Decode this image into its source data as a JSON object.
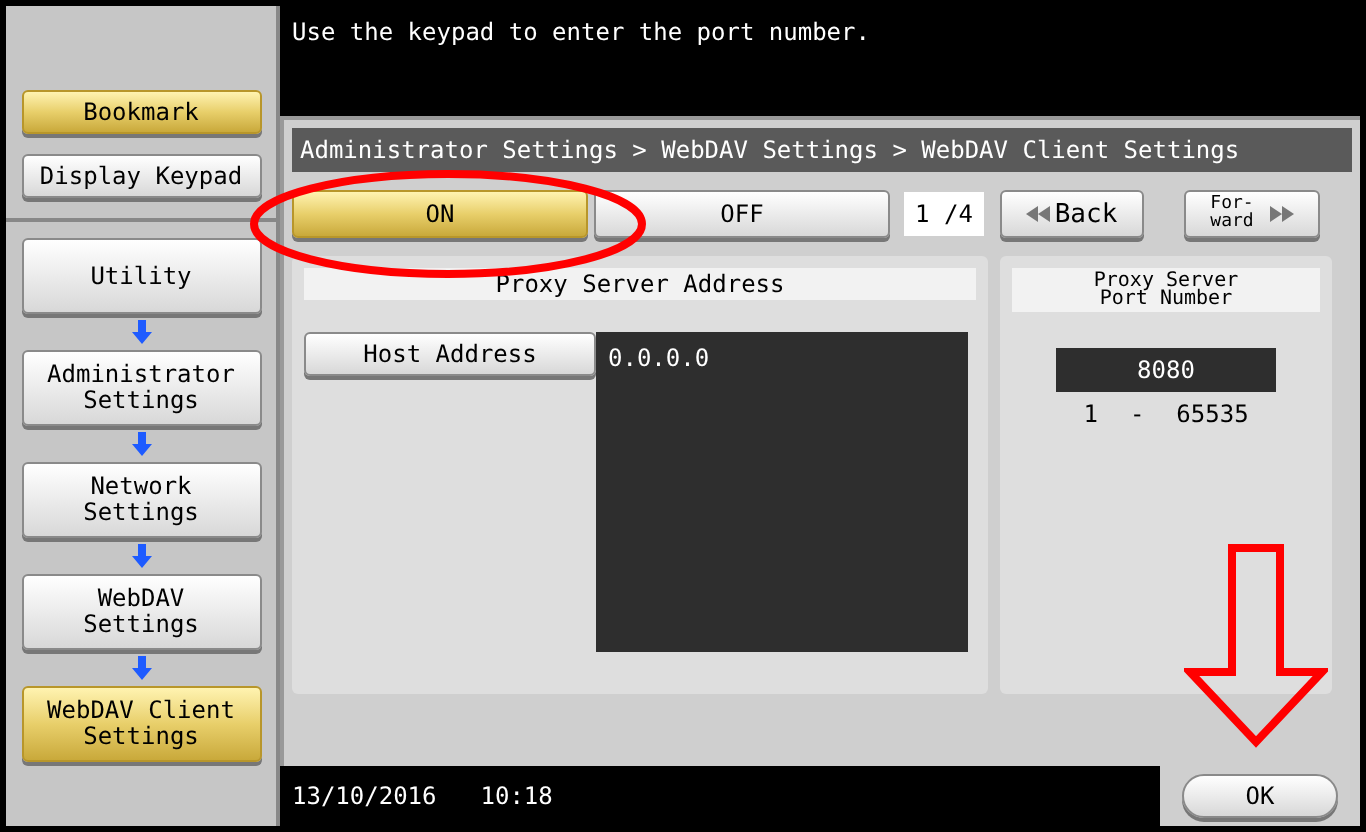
{
  "message": "Use the keypad to enter the port number.",
  "sidebar": {
    "top_buttons": [
      {
        "label": "Bookmark",
        "selected": true
      },
      {
        "label": "Display Keypad",
        "selected": false
      }
    ],
    "path": [
      {
        "label": "Utility",
        "selected": false
      },
      {
        "label": "Administrator Settings",
        "selected": false
      },
      {
        "label": "Network Settings",
        "selected": false
      },
      {
        "label": "WebDAV Settings",
        "selected": false
      },
      {
        "label": "WebDAV Client Settings",
        "selected": true
      }
    ]
  },
  "breadcrumb": "Administrator Settings > WebDAV Settings > WebDAV Client Settings",
  "toggle": [
    {
      "label": "ON",
      "selected": true
    },
    {
      "label": "OFF",
      "selected": false
    }
  ],
  "page": "1 /4",
  "back": "Back",
  "forward": [
    "For-",
    "ward"
  ],
  "proxy_address": {
    "title": "Proxy Server Address",
    "button": "Host Address",
    "value": "0.0.0.0"
  },
  "proxy_port": {
    "title": [
      "Proxy Server",
      "Port Number"
    ],
    "value": "8080",
    "range_min": "1",
    "range_sep": "-",
    "range_max": "65535"
  },
  "status": {
    "date": "13/10/2016",
    "time": "10:18"
  },
  "ok": "OK"
}
